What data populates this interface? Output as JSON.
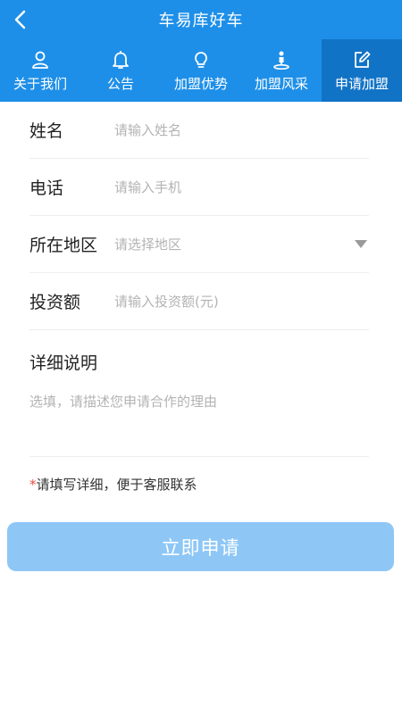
{
  "header": {
    "title": "车易库好车",
    "back_icon": "chevron-left-icon"
  },
  "tabs": [
    {
      "label": "关于我们",
      "icon": "user-icon",
      "active": false
    },
    {
      "label": "公告",
      "icon": "bell-icon",
      "active": false
    },
    {
      "label": "加盟优势",
      "icon": "lightbulb-icon",
      "active": false
    },
    {
      "label": "加盟风采",
      "icon": "location-person-icon",
      "active": false
    },
    {
      "label": "申请加盟",
      "icon": "edit-icon",
      "active": true
    }
  ],
  "form": {
    "name": {
      "label": "姓名",
      "placeholder": "请输入姓名"
    },
    "phone": {
      "label": "电话",
      "placeholder": "请输入手机"
    },
    "region": {
      "label": "所在地区",
      "placeholder": "请选择地区"
    },
    "investment": {
      "label": "投资额",
      "placeholder": "请输入投资额(元)"
    },
    "details": {
      "label": "详细说明",
      "placeholder": "选填，请描述您申请合作的理由"
    }
  },
  "note": {
    "star": "*",
    "text": "请填写详细，便于客服联系"
  },
  "submit_label": "立即申请",
  "colors": {
    "primary": "#1e8fe8",
    "active_tab": "#1173c6",
    "button": "#8ec7f6"
  }
}
